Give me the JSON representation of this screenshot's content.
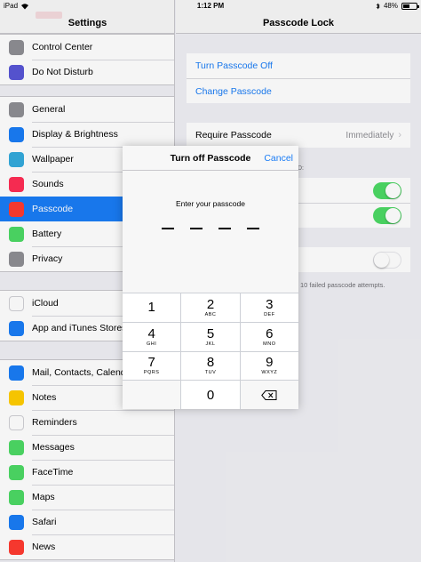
{
  "status_bar": {
    "device": "iPad",
    "time": "1:12 PM",
    "battery": "48%",
    "battery_level": 0.48
  },
  "sidebar": {
    "title": "Settings",
    "groups": [
      [
        {
          "label": "Control Center",
          "icon": "control-center-icon",
          "color": "#8e8e93"
        },
        {
          "label": "Do Not Disturb",
          "icon": "moon-icon",
          "color": "#5856d6"
        }
      ],
      [
        {
          "label": "General",
          "icon": "gear-icon",
          "color": "#8e8e93"
        },
        {
          "label": "Display & Brightness",
          "icon": "display-icon",
          "color": "#1a7cf5"
        },
        {
          "label": "Wallpaper",
          "icon": "wallpaper-icon",
          "color": "#34aadc"
        },
        {
          "label": "Sounds",
          "icon": "speaker-icon",
          "color": "#ff2d55"
        },
        {
          "label": "Passcode",
          "icon": "lock-icon",
          "color": "#ff3b30",
          "selected": true
        },
        {
          "label": "Battery",
          "icon": "battery-icon",
          "color": "#4cd964"
        },
        {
          "label": "Privacy",
          "icon": "hand-icon",
          "color": "#8e8e93"
        }
      ],
      [
        {
          "label": "iCloud",
          "icon": "cloud-icon",
          "color": "#ffffff"
        },
        {
          "label": "App and iTunes Stores",
          "icon": "app-store-icon",
          "color": "#1a7cf5"
        }
      ],
      [
        {
          "label": "Mail, Contacts, Calendars",
          "icon": "mail-icon",
          "color": "#1a7cf5"
        },
        {
          "label": "Notes",
          "icon": "notes-icon",
          "color": "#ffcc00"
        },
        {
          "label": "Reminders",
          "icon": "reminders-icon",
          "color": "#ffffff"
        },
        {
          "label": "Messages",
          "icon": "messages-icon",
          "color": "#4cd964"
        },
        {
          "label": "FaceTime",
          "icon": "facetime-icon",
          "color": "#4cd964"
        },
        {
          "label": "Maps",
          "icon": "maps-icon",
          "color": "#4cd964"
        },
        {
          "label": "Safari",
          "icon": "safari-icon",
          "color": "#1a7cf5"
        },
        {
          "label": "News",
          "icon": "news-icon",
          "color": "#ff3b30"
        }
      ]
    ]
  },
  "detail": {
    "title": "Passcode Lock",
    "turn_off": "Turn Passcode Off",
    "change": "Change Passcode",
    "require_label": "Require Passcode",
    "require_value": "Immediately",
    "section_header_tail": "D:",
    "erase_note": "10 failed passcode attempts.",
    "toggles": [
      true,
      true,
      false
    ]
  },
  "modal": {
    "title": "Turn off Passcode",
    "cancel": "Cancel",
    "prompt": "Enter your passcode",
    "keys": [
      {
        "num": "1",
        "letters": ""
      },
      {
        "num": "2",
        "letters": "ABC"
      },
      {
        "num": "3",
        "letters": "DEF"
      },
      {
        "num": "4",
        "letters": "GHI"
      },
      {
        "num": "5",
        "letters": "JKL"
      },
      {
        "num": "6",
        "letters": "MNO"
      },
      {
        "num": "7",
        "letters": "PQRS"
      },
      {
        "num": "8",
        "letters": "TUV"
      },
      {
        "num": "9",
        "letters": "WXYZ"
      },
      {
        "num": "0",
        "letters": ""
      }
    ]
  },
  "colors": {
    "accent": "#1a7cf5",
    "toggle_on": "#4cd964"
  }
}
